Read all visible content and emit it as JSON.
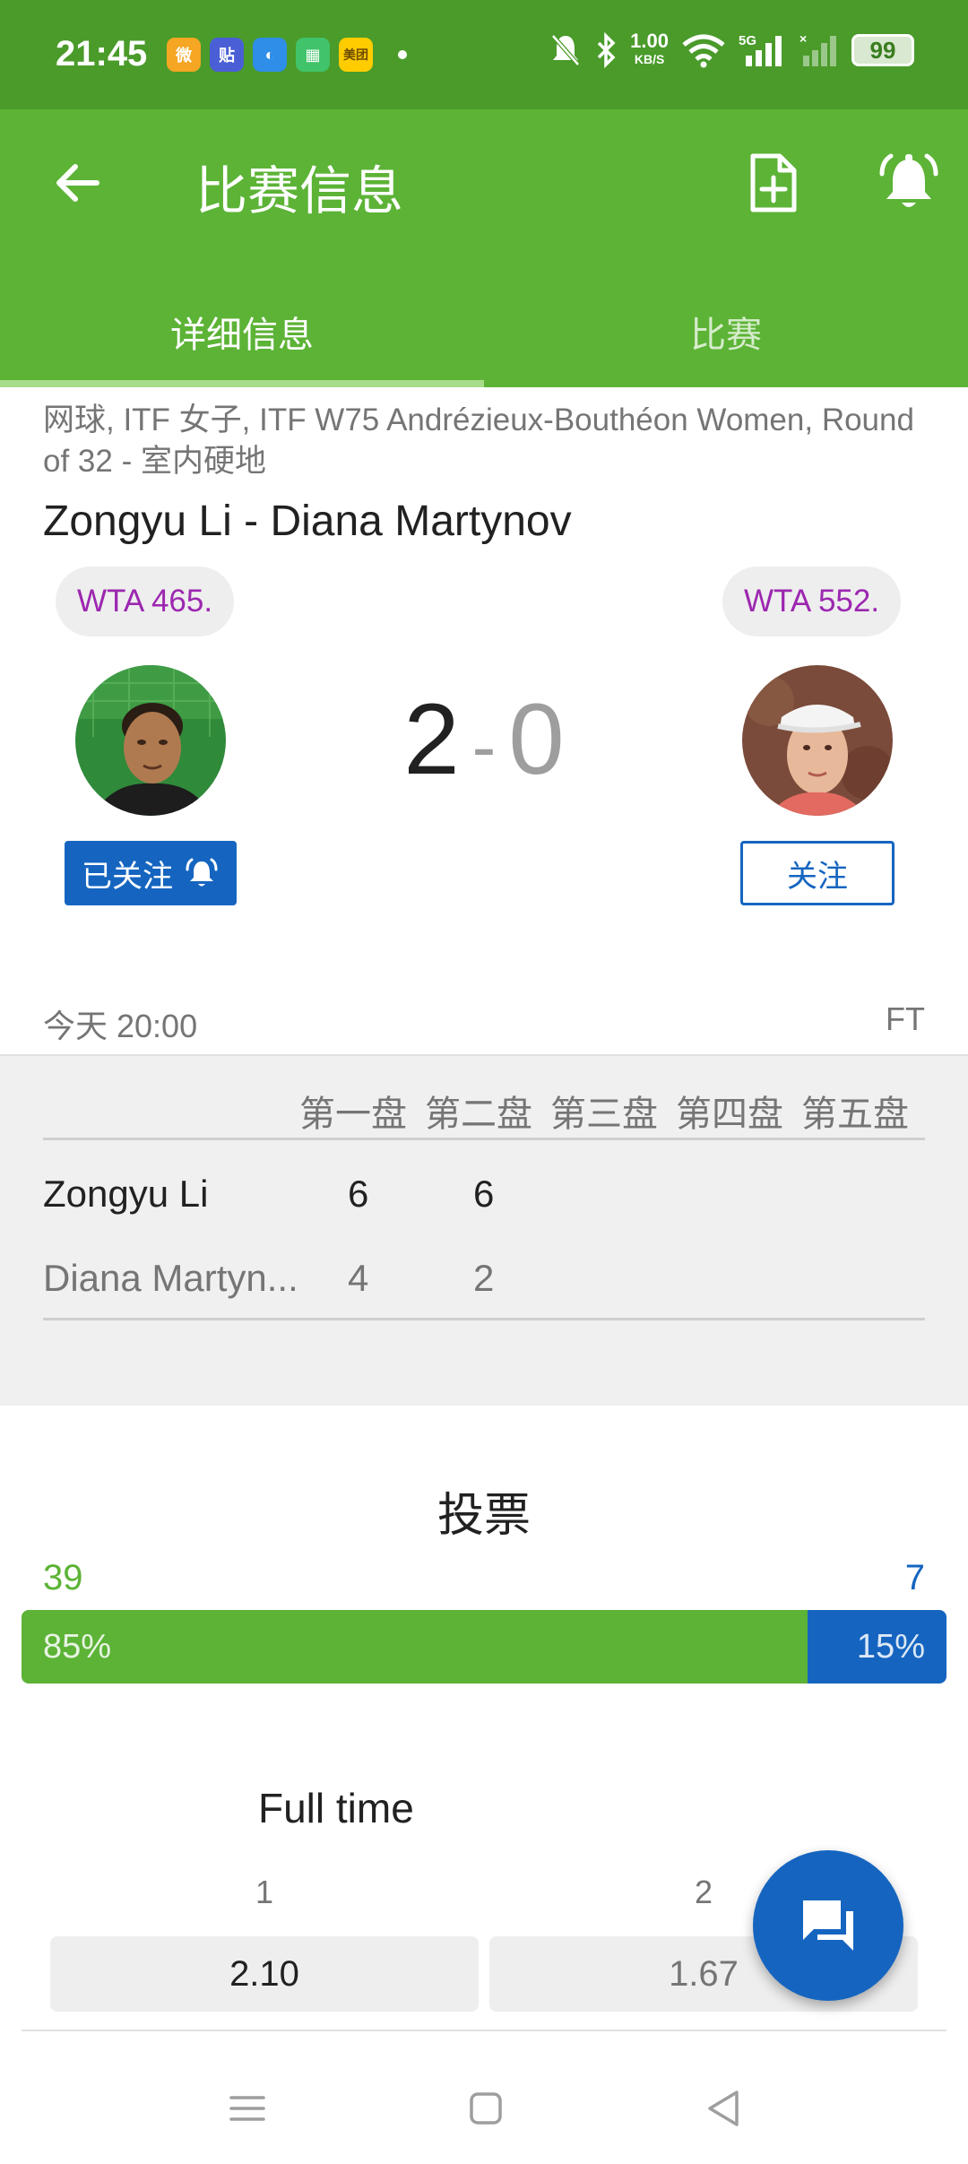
{
  "status_bar": {
    "time": "21:45",
    "apps": [
      {
        "icon": "weibo-icon",
        "label": "微",
        "color": "#f5a623"
      },
      {
        "icon": "tieba-icon",
        "label": "贴",
        "color": "#4a5fd6"
      },
      {
        "icon": "browser-icon",
        "label": "◐",
        "color": "#2f8ee8"
      },
      {
        "icon": "app-store-icon",
        "label": "▦",
        "color": "#41c36a"
      },
      {
        "icon": "meituan-icon",
        "label": "美团",
        "color": "#ffcc00"
      }
    ],
    "net_speed": "1.00",
    "net_speed_unit": "KB/S",
    "signal": "5G",
    "battery": "99"
  },
  "app_bar": {
    "title": "比赛信息"
  },
  "tabs": [
    {
      "label": "详细信息",
      "active": true
    },
    {
      "label": "比赛",
      "active": false
    }
  ],
  "match": {
    "meta": "网球, ITF 女子, ITF W75 Andrézieux-Bouthéon Women, Round of 32 - 室内硬地",
    "title": "Zongyu Li - Diana Martynov",
    "home": {
      "rank": "WTA 465.",
      "follow_label": "已关注"
    },
    "away": {
      "rank": "WTA 552.",
      "follow_label": "关注"
    },
    "score_home": "2",
    "score_sep": "-",
    "score_away": "0",
    "time": "今天 20:00",
    "status": "FT"
  },
  "sets": {
    "headers": [
      "第一盘",
      "第二盘",
      "第三盘",
      "第四盘",
      "第五盘"
    ],
    "rows": [
      {
        "name": "Zongyu Li",
        "scores": [
          "6",
          "6"
        ]
      },
      {
        "name": "Diana Martyn...",
        "scores": [
          "4",
          "2"
        ]
      }
    ]
  },
  "vote": {
    "title": "投票",
    "home_count": "39",
    "away_count": "7",
    "home_pct_label": "85%",
    "away_pct_label": "15%",
    "home_fraction": 0.85,
    "colors": {
      "home": "#5cb336",
      "away": "#1565c0"
    }
  },
  "odds": {
    "title": "Full time",
    "labels": [
      "1",
      "2"
    ],
    "values": [
      "2.10",
      "1.67"
    ]
  },
  "colors": {
    "primary": "#5cb336",
    "status_bar": "#4a9b2a",
    "accent_blue": "#1565c0",
    "rank_text": "#9c27b0"
  }
}
